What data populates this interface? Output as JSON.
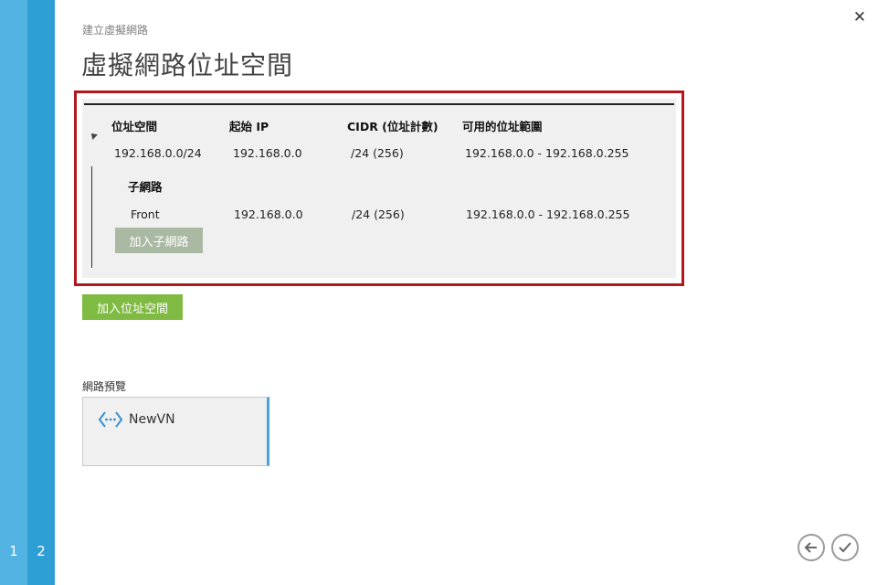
{
  "wizard": {
    "steps": [
      "1",
      "2"
    ],
    "breadcrumb": "建立虛擬網路",
    "title": "虛擬網路位址空間"
  },
  "address_table": {
    "headers": {
      "address_space": "位址空間",
      "starting_ip": "起始 IP",
      "cidr": "CIDR (位址計數)",
      "usable_range": "可用的位址範圍"
    },
    "address_space_row": {
      "address_space": "192.168.0.0/24",
      "starting_ip": "192.168.0.0",
      "cidr": "/24 (256)",
      "usable_range": "192.168.0.0 - 192.168.0.255"
    },
    "subnets": {
      "title": "子網路",
      "rows": [
        {
          "name": "Front",
          "starting_ip": "192.168.0.0",
          "cidr": "/24 (256)",
          "usable_range": "192.168.0.0 - 192.168.0.255"
        }
      ],
      "add_label": "加入子網路"
    }
  },
  "add_address_space_label": "加入位址空間",
  "network_preview": {
    "label": "網路預覽",
    "vnet_name": "NewVN",
    "icon": "virtual-network-icon"
  },
  "footer": {
    "back_icon": "arrow-left-icon",
    "complete_icon": "checkmark-icon"
  },
  "colors": {
    "rail_light": "#52b3e2",
    "rail_dark": "#2e9fd4",
    "highlight_border": "#b01a1f",
    "add_address_space_button": "#7fba42",
    "add_subnet_button_disabled": "#a9b9a2",
    "preview_accent": "#4aa3dc"
  }
}
